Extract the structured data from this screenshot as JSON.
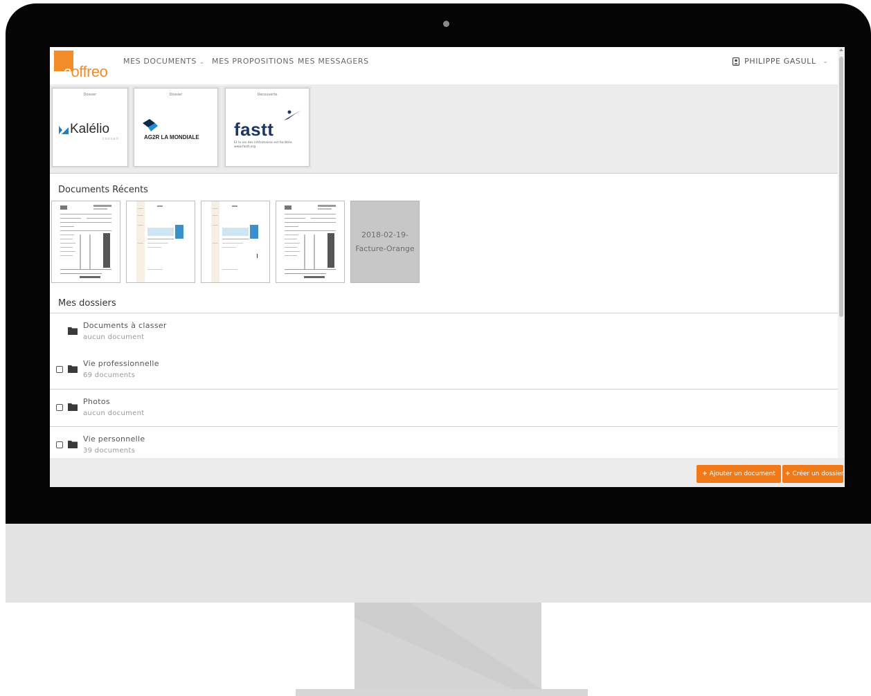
{
  "logo": {
    "first_letter": "c",
    "rest": "offreo"
  },
  "nav": {
    "items": [
      {
        "label": "MES DOCUMENTS",
        "has_caret": true
      },
      {
        "label": "MES PROPOSITIONS"
      },
      {
        "label": "MES MESSAGERS"
      }
    ],
    "caret": "⌄",
    "user_name": "PHILIPPE GASULL"
  },
  "partners": [
    {
      "tag": "Dossier",
      "name": "Kalélio",
      "sub": "conseil"
    },
    {
      "tag": "Dossier",
      "name": "AG2R LA MONDIALE"
    },
    {
      "tag": "Découverte",
      "name": "fastt",
      "sub": "Et la vie des intérimaires est facilitée www.fastt.org"
    }
  ],
  "recent": {
    "title": "Documents Récents",
    "last_doc_label": "2018-02-19-Facture-Orange"
  },
  "folders": {
    "title": "Mes dossiers",
    "items": [
      {
        "name": "Documents à classer",
        "count": "aucun document"
      },
      {
        "name": "Vie professionnelle",
        "count": "69 documents"
      },
      {
        "name": "Photos",
        "count": "aucun document"
      },
      {
        "name": "Vie personnelle",
        "count": "39 documents"
      }
    ]
  },
  "actions": {
    "add_document": "Ajouter un document",
    "create_folder": "Créer un dossier",
    "plus": "+"
  },
  "colors": {
    "brand_orange": "#f28c28",
    "button_orange": "#f07a1a",
    "kalelio_blue": "#1e7fc2",
    "fastt_navy": "#1b3660"
  }
}
